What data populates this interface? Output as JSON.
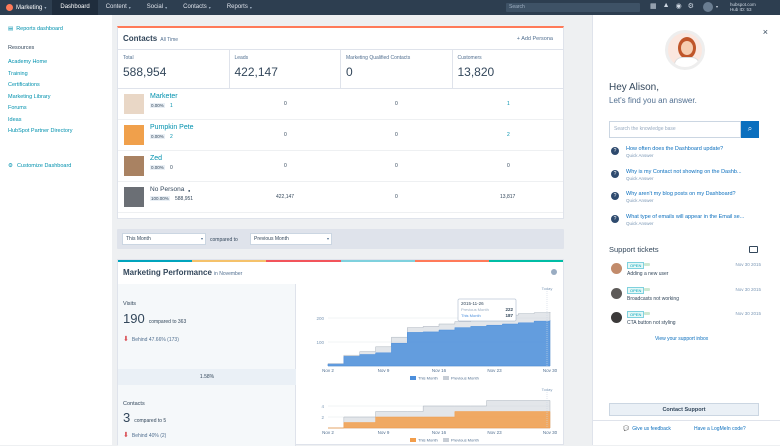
{
  "topbar": {
    "brand": "Marketing",
    "nav": [
      {
        "label": "Dashboard",
        "active": true
      },
      {
        "label": "Content",
        "caret": true
      },
      {
        "label": "Social",
        "caret": true
      },
      {
        "label": "Contacts",
        "caret": true
      },
      {
        "label": "Reports",
        "caret": true
      }
    ],
    "search_placeholder": "Search",
    "account_line1": "hubspot.com",
    "account_line2": "Hub ID: 53",
    "icons": [
      "calendar-icon",
      "academy-icon",
      "broadcast-icon",
      "gear-icon"
    ]
  },
  "sidebar": {
    "back_label": "Reports dashboard",
    "resources_heading": "Resources",
    "items": [
      "Academy Home",
      "Training",
      "Certifications",
      "Marketing Library",
      "Forums",
      "Ideas",
      "HubSpot Partner Directory"
    ],
    "customize_label": "Customize Dashboard"
  },
  "contacts": {
    "title": "Contacts",
    "subtitle": "All Time",
    "add_label": "Add Persona",
    "stats": [
      {
        "label": "Total",
        "value": "588,954"
      },
      {
        "label": "Leads",
        "value": "422,147"
      },
      {
        "label": "Marketing Qualified Contacts",
        "value": "0"
      },
      {
        "label": "Customers",
        "value": "13,820"
      }
    ],
    "rows": [
      {
        "name": "Marketer",
        "pct": "0.00%",
        "count": "1",
        "leads": "0",
        "mqc": "0",
        "customers": "1"
      },
      {
        "name": "Pumpkin Pete",
        "pct": "0.00%",
        "count": "2",
        "leads": "0",
        "mqc": "0",
        "customers": "2"
      },
      {
        "name": "Zed",
        "pct": "0.00%",
        "count": "0",
        "leads": "0",
        "mqc": "0",
        "customers": "0"
      },
      {
        "name": "No Persona",
        "pct": "100.00%",
        "count": "588,951",
        "leads": "422,147",
        "mqc": "0",
        "customers": "13,817"
      }
    ]
  },
  "filters": {
    "period": "This Month",
    "compared_label": "compared to",
    "compare_period": "Previous Month"
  },
  "performance": {
    "title": "Marketing Performance",
    "subtitle": "in November",
    "colors": [
      "#00a4bd",
      "#f5c26b",
      "#f2545b",
      "#7fd1de",
      "#ff7a59",
      "#00bda5"
    ],
    "visits": {
      "label": "Visits",
      "value": "190",
      "compare": "compared to 363",
      "behind": "Behind 47.66% (173)"
    },
    "conversion": "1.58%",
    "contacts": {
      "label": "Contacts",
      "value": "3",
      "compare": "compared to 5",
      "behind": "Behind 40% (2)"
    }
  },
  "chart_data": [
    {
      "type": "area",
      "title": "Visits",
      "x": [
        "Nov 2",
        "Nov 9",
        "Nov 16",
        "Nov 23",
        "Nov 30"
      ],
      "ylim": [
        0,
        300
      ],
      "yticks": [
        100,
        200
      ],
      "today_label": "Today",
      "tooltip": {
        "date": "2015-11-26",
        "rows": [
          {
            "name": "Previous Month",
            "value": "222"
          },
          {
            "name": "This Month",
            "value": "187"
          }
        ]
      },
      "series": [
        {
          "name": "This Month",
          "color": "#4c8fdc",
          "values": [
            8,
            40,
            48,
            55,
            95,
            140,
            142,
            150,
            160,
            165,
            170,
            175,
            180,
            187,
            190
          ]
        },
        {
          "name": "Previous Month",
          "color": "#c7cdd5",
          "values": [
            10,
            45,
            60,
            80,
            120,
            160,
            165,
            175,
            185,
            195,
            205,
            212,
            218,
            222,
            225
          ]
        }
      ]
    },
    {
      "type": "area",
      "title": "Contacts",
      "x": [
        "Nov 2",
        "Nov 9",
        "Nov 16",
        "Nov 23",
        "Nov 30"
      ],
      "ylim": [
        0,
        6
      ],
      "yticks": [
        2,
        4
      ],
      "today_label": "Today",
      "series": [
        {
          "name": "This Month",
          "color": "#f29d4b",
          "values": [
            0,
            1,
            1,
            2,
            2,
            2,
            2,
            2,
            3,
            3,
            3,
            3,
            3,
            3,
            3
          ]
        },
        {
          "name": "Previous Month",
          "color": "#c7cdd5",
          "values": [
            0,
            2,
            2,
            3,
            3,
            3,
            4,
            4,
            4,
            4,
            5,
            5,
            5,
            5,
            5
          ]
        }
      ]
    }
  ],
  "assistant": {
    "greeting": "Hey Alison,",
    "subgreeting": "Let's find you an answer.",
    "search_placeholder": "Search the knowledge base",
    "questions": [
      {
        "q": "How often does the Dashboard update?",
        "tag": "Quick Answer"
      },
      {
        "q": "Why is my Contact not showing on the Dashb...",
        "tag": "Quick Answer"
      },
      {
        "q": "Why aren't my blog posts on my Dashboard?",
        "tag": "Quick Answer"
      },
      {
        "q": "What type of emails will appear in the Email se...",
        "tag": "Quick Answer"
      }
    ],
    "tickets_heading": "Support tickets",
    "tickets": [
      {
        "status": "OPEN",
        "date": "Nov 30 2015",
        "title": "Adding a new user"
      },
      {
        "status": "OPEN",
        "date": "Nov 30 2015",
        "title": "Broadcasts not working"
      },
      {
        "status": "OPEN",
        "date": "Nov 30 2015",
        "title": "CTA button not styling"
      }
    ],
    "view_inbox": "View your support inbox",
    "contact_support": "Contact Support",
    "feedback": "Give us feedback",
    "logmein": "Have a LogMeIn code?"
  }
}
